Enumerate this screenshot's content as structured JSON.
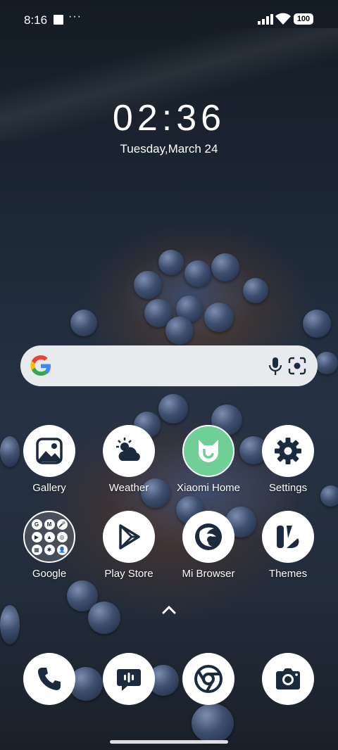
{
  "status_bar": {
    "time": "8:16",
    "extra": "···",
    "battery": "100"
  },
  "clock": {
    "time": "02:36",
    "date": "Tuesday,March 24"
  },
  "search": {
    "placeholder": ""
  },
  "apps_row1": [
    {
      "label": "Gallery",
      "icon": "gallery-icon"
    },
    {
      "label": "Weather",
      "icon": "weather-icon"
    },
    {
      "label": "Xiaomi Home",
      "icon": "xiaomi-home-icon"
    },
    {
      "label": "Settings",
      "icon": "gear-icon"
    }
  ],
  "apps_row2": [
    {
      "label": "Google",
      "icon": "google-folder-icon"
    },
    {
      "label": "Play Store",
      "icon": "play-store-icon"
    },
    {
      "label": "Mi Browser",
      "icon": "mi-browser-icon"
    },
    {
      "label": "Themes",
      "icon": "themes-icon"
    }
  ],
  "folder_items": [
    "G",
    "M",
    "🎤",
    "▶",
    "▲",
    "◎",
    "▦",
    "✱",
    "👤"
  ],
  "dock": [
    {
      "icon": "phone-icon"
    },
    {
      "icon": "messages-icon"
    },
    {
      "icon": "chrome-icon"
    },
    {
      "icon": "camera-icon"
    }
  ],
  "colors": {
    "icon_bg": "#ffffff",
    "icon_fg": "#1b2a3c",
    "xiaomi_home_bg": "#6fcf97",
    "search_bg": "#f2f4f7"
  }
}
